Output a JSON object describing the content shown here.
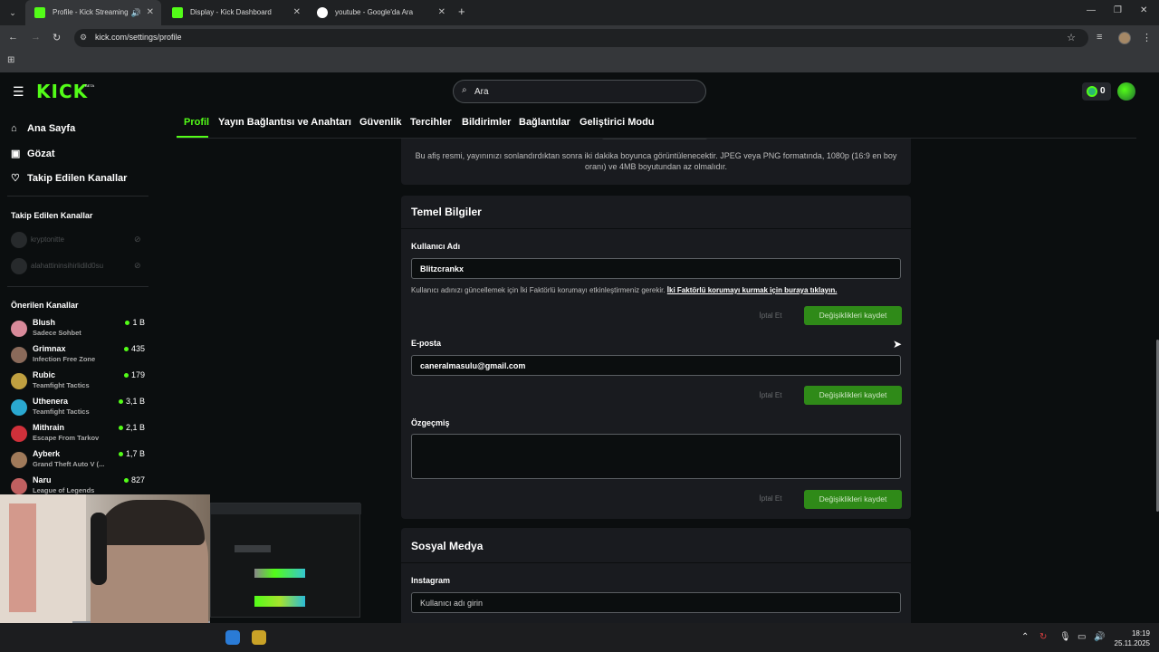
{
  "browser": {
    "tabs": [
      {
        "title": "Profile - Kick Streaming",
        "active": true
      },
      {
        "title": "Display - Kick Dashboard",
        "active": false
      },
      {
        "title": "youtube - Google'da Ara",
        "active": false
      }
    ],
    "url": "kick.com/settings/profile"
  },
  "header": {
    "logo": "KICK",
    "logo_badge": "BETA",
    "search_placeholder": "Ara",
    "kicks_count": "0"
  },
  "sidebar": {
    "nav": [
      {
        "label": "Ana Sayfa",
        "icon": "home-icon"
      },
      {
        "label": "Gözat",
        "icon": "browse-icon"
      },
      {
        "label": "Takip Edilen Kanallar",
        "icon": "heart-icon"
      }
    ],
    "followed_title": "Takip Edilen Kanallar",
    "followed": [
      {
        "name": "kryptonitte"
      },
      {
        "name": "alahattininsihirlidild0su"
      }
    ],
    "recommended_title": "Önerilen Kanallar",
    "recommended": [
      {
        "name": "Blush",
        "category": "Sadece Sohbet",
        "viewers": "1 B",
        "color": "#d88a9a"
      },
      {
        "name": "Grimnax",
        "category": "Infection Free Zone",
        "viewers": "435",
        "color": "#8a6a5a"
      },
      {
        "name": "Rubic",
        "category": "Teamfight Tactics",
        "viewers": "179",
        "color": "#c0a040"
      },
      {
        "name": "Uthenera",
        "category": "Teamfight Tactics",
        "viewers": "3,1 B",
        "color": "#2aa8d0"
      },
      {
        "name": "Mithrain",
        "category": "Escape From Tarkov",
        "viewers": "2,1 B",
        "color": "#d0303a"
      },
      {
        "name": "Ayberk",
        "category": "Grand Theft Auto V (...",
        "viewers": "1,7 B",
        "color": "#a07a5a"
      },
      {
        "name": "Naru",
        "category": "League of Legends",
        "viewers": "827",
        "color": "#c06060"
      }
    ]
  },
  "settings_tabs": [
    "Profil",
    "Yayın Bağlantısı ve Anahtarı",
    "Güvenlik",
    "Tercihler",
    "Bildirimler",
    "Bağlantılar",
    "Geliştirici Modu"
  ],
  "banner": {
    "description": "Bu afiş resmi, yayınınızı sonlandırdıktan sonra iki dakika boyunca görüntülenecektir. JPEG veya PNG formatında, 1080p (16:9 en boy oranı) ve 4MB boyutundan az olmalıdır."
  },
  "basic_info": {
    "title": "Temel Bilgiler",
    "username_label": "Kullanıcı Adı",
    "username_value": "Blitzcrankx",
    "username_hint": "Kullanıcı adınızı güncellemek için İki Faktörlü korumayı etkinleştirmeniz gerekir.",
    "username_hint_link": "İki Faktörlü korumayı kurmak için buraya tıklayın.",
    "email_label": "E-posta",
    "email_value": "caneralmasulu@gmail.com",
    "bio_label": "Özgeçmiş",
    "bio_value": "",
    "cancel_label": "İptal Et",
    "save_label": "Değişiklikleri kaydet"
  },
  "social": {
    "title": "Sosyal Medya",
    "instagram_label": "Instagram",
    "instagram_placeholder": "Kullanıcı adı girin"
  },
  "taskbar": {
    "time": "18:19",
    "date": "25.11.2025"
  },
  "colors": {
    "accent": "#53fc18",
    "background": "#0b0e0f",
    "card": "#191b1f",
    "save_button": "#2f8a18"
  }
}
